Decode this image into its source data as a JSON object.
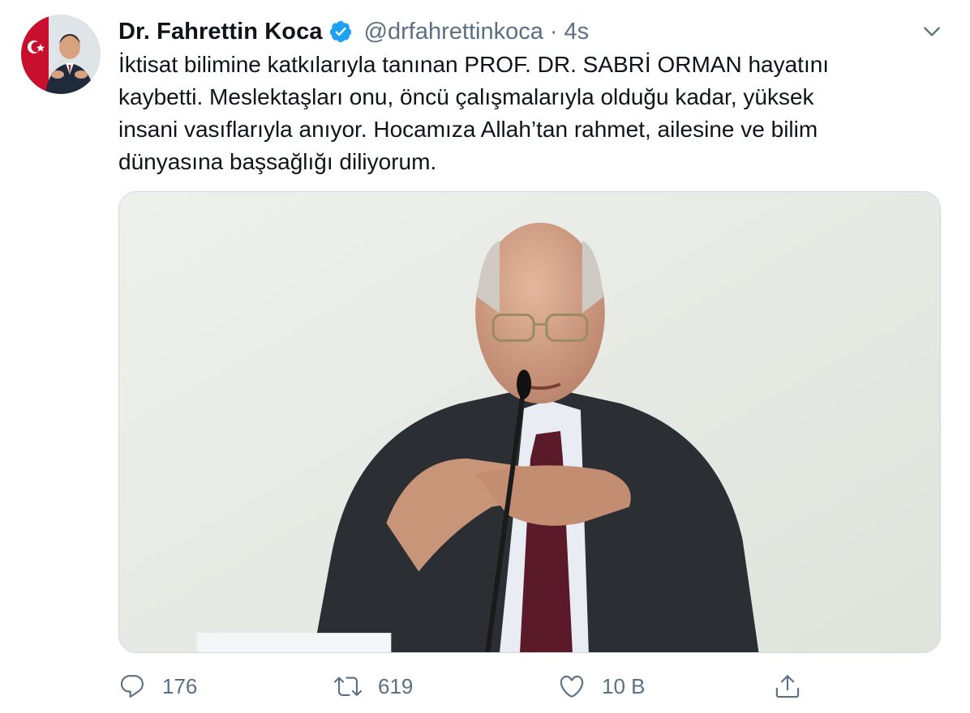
{
  "author": {
    "name": "Dr. Fahrettin Koca",
    "handle": "@drfahrettinkoca",
    "separator": "·",
    "time": "4s",
    "verified": true,
    "avatar_icon": "profile-photo"
  },
  "tweet": {
    "lines": [
      "İktisat bilimine katkılarıyla tanınan PROF. DR. SABRİ ORMAN hayatını",
      "kaybetti. Meslektaşları onu, öncü çalışmalarıyla olduğu kadar, yüksek",
      "insani vasıflarıyla anıyor. Hocamıza Allah’tan rahmet, ailesine ve bilim",
      "dünyasına başsağlığı diliyorum."
    ]
  },
  "media": {
    "type": "photo"
  },
  "actions": {
    "reply_count": "176",
    "retweet_count": "619",
    "like_count": "10 B",
    "icons": [
      "reply-icon",
      "retweet-icon",
      "like-icon",
      "share-icon"
    ]
  },
  "colors": {
    "text": "#0f1419",
    "secondary": "#5b7083",
    "verified": "#1da1f2",
    "border": "#cfd9de"
  }
}
